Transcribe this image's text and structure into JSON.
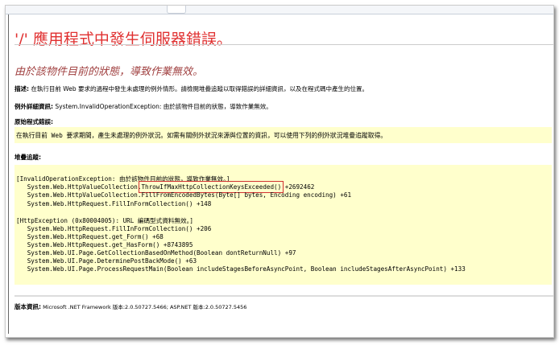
{
  "title": "'/' 應用程式中發生伺服器錯誤。",
  "subtitle": "由於該物件目前的狀態，導致作業無效。",
  "description": {
    "label": "描述:",
    "text": " 在執行目前 Web 要求的過程中發生未處理的例外情形。請檢閱堆疊追蹤以取得錯誤的詳細資訊，以及在程式碼中產生的位置。"
  },
  "exception_details": {
    "label": "例外詳細資訊:",
    "text": " System.InvalidOperationException: 由於該物件目前的狀態，導致作業無效。"
  },
  "source_error": {
    "label": "原始程式錯誤:",
    "text": "在執行目前 Web 要求期間，產生未處理的例外狀況。如需有關例外狀況來源與位置的資訊，可以使用下列的例外狀況堆疊追蹤取得。"
  },
  "stack_trace": {
    "label": "堆疊追蹤:",
    "line0": "[InvalidOperationException: 由於該物件目前的狀態，導致作業無效。]",
    "line1_pre": "   System.Web.HttpValueCollection.",
    "line1_hl": "ThrowIfMaxHttpCollectionKeysExceeded()",
    "line1_post": " +2692462",
    "lines_a": [
      "   System.Web.HttpValueCollection.FillFromEncodedBytes(Byte[] bytes, Encoding encoding) +61",
      "   System.Web.HttpRequest.FillInFormCollection() +148"
    ],
    "lines_b": [
      "[HttpException (0x80004005): URL 編碼型式資料無效。]",
      "   System.Web.HttpRequest.FillInFormCollection() +206",
      "   System.Web.HttpRequest.get_Form() +68",
      "   System.Web.HttpRequest.get_HasForm() +8743895",
      "   System.Web.UI.Page.GetCollectionBasedOnMethod(Boolean dontReturnNull) +97",
      "   System.Web.UI.Page.DeterminePostBackMode() +63",
      "   System.Web.UI.Page.ProcessRequestMain(Boolean includeStagesBeforeAsyncPoint, Boolean includeStagesAfterAsyncPoint) +133"
    ]
  },
  "version": {
    "label": "版本資訊:",
    "text": " Microsoft .NET Framework 版本:2.0.50727.5466; ASP.NET 版本:2.0.50727.5456"
  }
}
